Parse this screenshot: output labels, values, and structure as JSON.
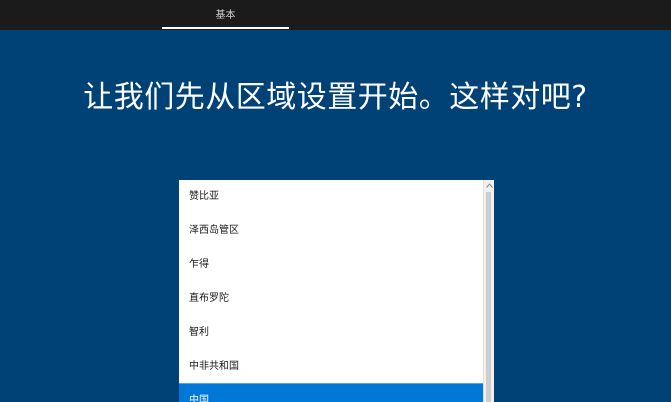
{
  "topbar": {
    "tab_label": "基本"
  },
  "heading": "让我们先从区域设置开始。这样对吧?",
  "region_list": {
    "items": [
      {
        "label": "赞比亚"
      },
      {
        "label": "泽西岛管区"
      },
      {
        "label": "乍得"
      },
      {
        "label": "直布罗陀"
      },
      {
        "label": "智利"
      },
      {
        "label": "中非共和国"
      },
      {
        "label": "中国",
        "selected": true
      }
    ]
  },
  "colors": {
    "background": "#004275",
    "topbar": "#1b1b1b",
    "selection": "#0078d7"
  }
}
